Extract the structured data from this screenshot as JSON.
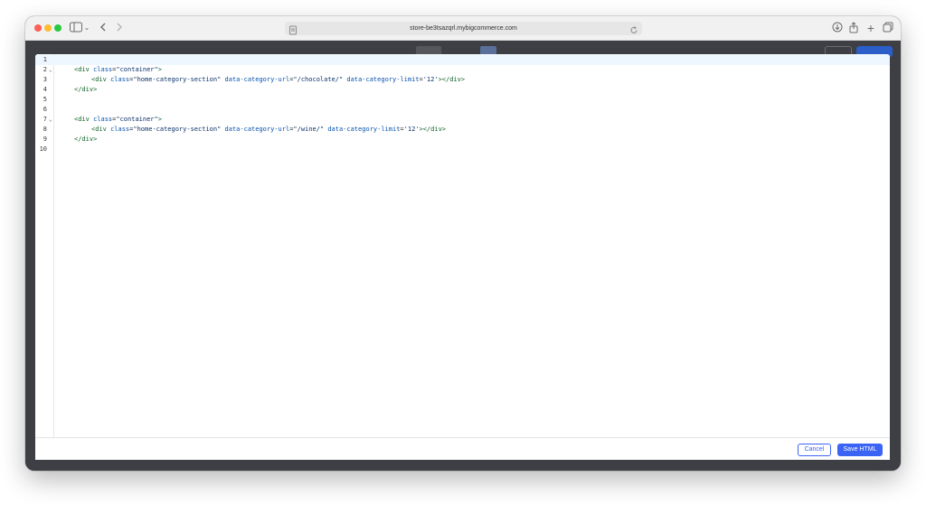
{
  "browser": {
    "url": "store-be3tsazqrl.mybigcommerce.com"
  },
  "editor": {
    "lines": [
      {
        "n": "1",
        "active": true,
        "fold": false,
        "indent": 0,
        "tokens": []
      },
      {
        "n": "2",
        "fold": true,
        "indent": 1,
        "tokens": [
          {
            "t": "tag",
            "v": "<div "
          },
          {
            "t": "attr",
            "v": "class"
          },
          {
            "t": "plain",
            "v": "="
          },
          {
            "t": "str",
            "v": "\"container\""
          },
          {
            "t": "tag",
            "v": ">"
          }
        ]
      },
      {
        "n": "3",
        "fold": false,
        "indent": 2,
        "tokens": [
          {
            "t": "tag",
            "v": "<div "
          },
          {
            "t": "attr",
            "v": "class"
          },
          {
            "t": "plain",
            "v": "="
          },
          {
            "t": "str",
            "v": "\"home-category-section\""
          },
          {
            "t": "plain",
            "v": " "
          },
          {
            "t": "attr",
            "v": "data-category-url"
          },
          {
            "t": "plain",
            "v": "="
          },
          {
            "t": "str",
            "v": "\"/chocolate/\""
          },
          {
            "t": "plain",
            "v": " "
          },
          {
            "t": "attr",
            "v": "data-category-limit"
          },
          {
            "t": "plain",
            "v": "="
          },
          {
            "t": "str",
            "v": "'12'"
          },
          {
            "t": "tag",
            "v": "></div>"
          }
        ]
      },
      {
        "n": "4",
        "fold": false,
        "indent": 1,
        "tokens": [
          {
            "t": "tag",
            "v": "</div>"
          }
        ]
      },
      {
        "n": "5",
        "fold": false,
        "indent": 0,
        "tokens": []
      },
      {
        "n": "6",
        "fold": false,
        "indent": 0,
        "tokens": []
      },
      {
        "n": "7",
        "fold": true,
        "indent": 1,
        "tokens": [
          {
            "t": "tag",
            "v": "<div "
          },
          {
            "t": "attr",
            "v": "class"
          },
          {
            "t": "plain",
            "v": "="
          },
          {
            "t": "str",
            "v": "\"container\""
          },
          {
            "t": "tag",
            "v": ">"
          }
        ]
      },
      {
        "n": "8",
        "fold": false,
        "indent": 2,
        "tokens": [
          {
            "t": "tag",
            "v": "<div "
          },
          {
            "t": "attr",
            "v": "class"
          },
          {
            "t": "plain",
            "v": "="
          },
          {
            "t": "str",
            "v": "\"home-category-section\""
          },
          {
            "t": "plain",
            "v": " "
          },
          {
            "t": "attr",
            "v": "data-category-url"
          },
          {
            "t": "plain",
            "v": "="
          },
          {
            "t": "str",
            "v": "\"/wine/\""
          },
          {
            "t": "plain",
            "v": " "
          },
          {
            "t": "attr",
            "v": "data-category-limit"
          },
          {
            "t": "plain",
            "v": "="
          },
          {
            "t": "str",
            "v": "'12'"
          },
          {
            "t": "tag",
            "v": "></div>"
          }
        ]
      },
      {
        "n": "9",
        "fold": false,
        "indent": 1,
        "tokens": [
          {
            "t": "tag",
            "v": "</div>"
          }
        ]
      },
      {
        "n": "10",
        "fold": false,
        "indent": 0,
        "tokens": []
      }
    ]
  },
  "footer": {
    "cancel_label": "Cancel",
    "save_label": "Save HTML"
  },
  "colors": {
    "primary_button": "#3c64f4",
    "active_line": "#eef7ff",
    "tag": "#116329",
    "attribute": "#0550ae",
    "string": "#0a3069"
  },
  "icons": [
    "sidebar-icon",
    "chevron-down-icon",
    "back-arrow-icon",
    "forward-arrow-icon",
    "page-icon",
    "reload-icon",
    "download-icon",
    "share-icon",
    "plus-icon",
    "tabs-icon"
  ]
}
